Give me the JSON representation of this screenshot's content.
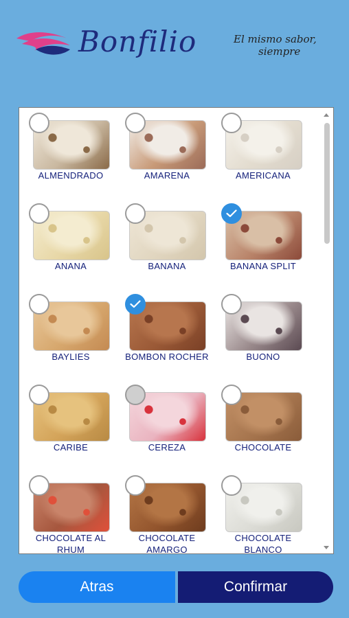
{
  "brand": {
    "name": "Bonfilio",
    "slogan_line1": "El mismo sabor,",
    "slogan_line2": "siempre",
    "accent": "#e0408a",
    "brand_color": "#1e2b7c"
  },
  "flavors": [
    {
      "label": "ALMENDRADO",
      "checked": false,
      "colors": [
        "#efe7d9",
        "#c9b8a0",
        "#8a6a48"
      ]
    },
    {
      "label": "AMARENA",
      "checked": false,
      "colors": [
        "#f1ece6",
        "#c89a78",
        "#9b6b58"
      ]
    },
    {
      "label": "AMERICANA",
      "checked": false,
      "colors": [
        "#f4f1ea",
        "#e3dccf",
        "#d6cfc4"
      ]
    },
    {
      "label": "ANANA",
      "checked": false,
      "colors": [
        "#f4ecd0",
        "#e8d8a8",
        "#d8c48a"
      ]
    },
    {
      "label": "BANANA",
      "checked": false,
      "colors": [
        "#eee6d6",
        "#e1d6c0",
        "#d3c6ac"
      ]
    },
    {
      "label": "BANANA SPLIT",
      "checked": true,
      "colors": [
        "#d9bfa6",
        "#b9846a",
        "#8c4a3a"
      ]
    },
    {
      "label": "BAYLIES",
      "checked": false,
      "colors": [
        "#e8c79a",
        "#d7a86e",
        "#c48a52"
      ]
    },
    {
      "label": "BOMBON ROCHER",
      "checked": true,
      "colors": [
        "#b7764e",
        "#9b5a37",
        "#7a4026"
      ]
    },
    {
      "label": "BUONO",
      "checked": false,
      "colors": [
        "#e9e4e2",
        "#9a8a8c",
        "#5b4a52"
      ]
    },
    {
      "label": "CARIBE",
      "checked": false,
      "colors": [
        "#e6c27e",
        "#d4a45a",
        "#b88a44"
      ]
    },
    {
      "label": "CEREZA",
      "checked": false,
      "grey": true,
      "colors": [
        "#f4d6dc",
        "#eab4c0",
        "#d8323c"
      ]
    },
    {
      "label": "CHOCOLATE",
      "checked": false,
      "colors": [
        "#c29066",
        "#a6754e",
        "#8a5c3a"
      ]
    },
    {
      "label": "CHOCOLATE AL RHUM",
      "checked": false,
      "colors": [
        "#c9846a",
        "#a6573e",
        "#e0503a"
      ]
    },
    {
      "label": "CHOCOLATE AMARGO",
      "checked": false,
      "colors": [
        "#b37545",
        "#94562e",
        "#6e3c1e"
      ]
    },
    {
      "label": "CHOCOLATE BLANCO",
      "checked": false,
      "colors": [
        "#f0f0ec",
        "#dcdcd6",
        "#c8c8c0"
      ]
    }
  ],
  "buttons": {
    "back": "Atras",
    "confirm": "Confirmar"
  }
}
